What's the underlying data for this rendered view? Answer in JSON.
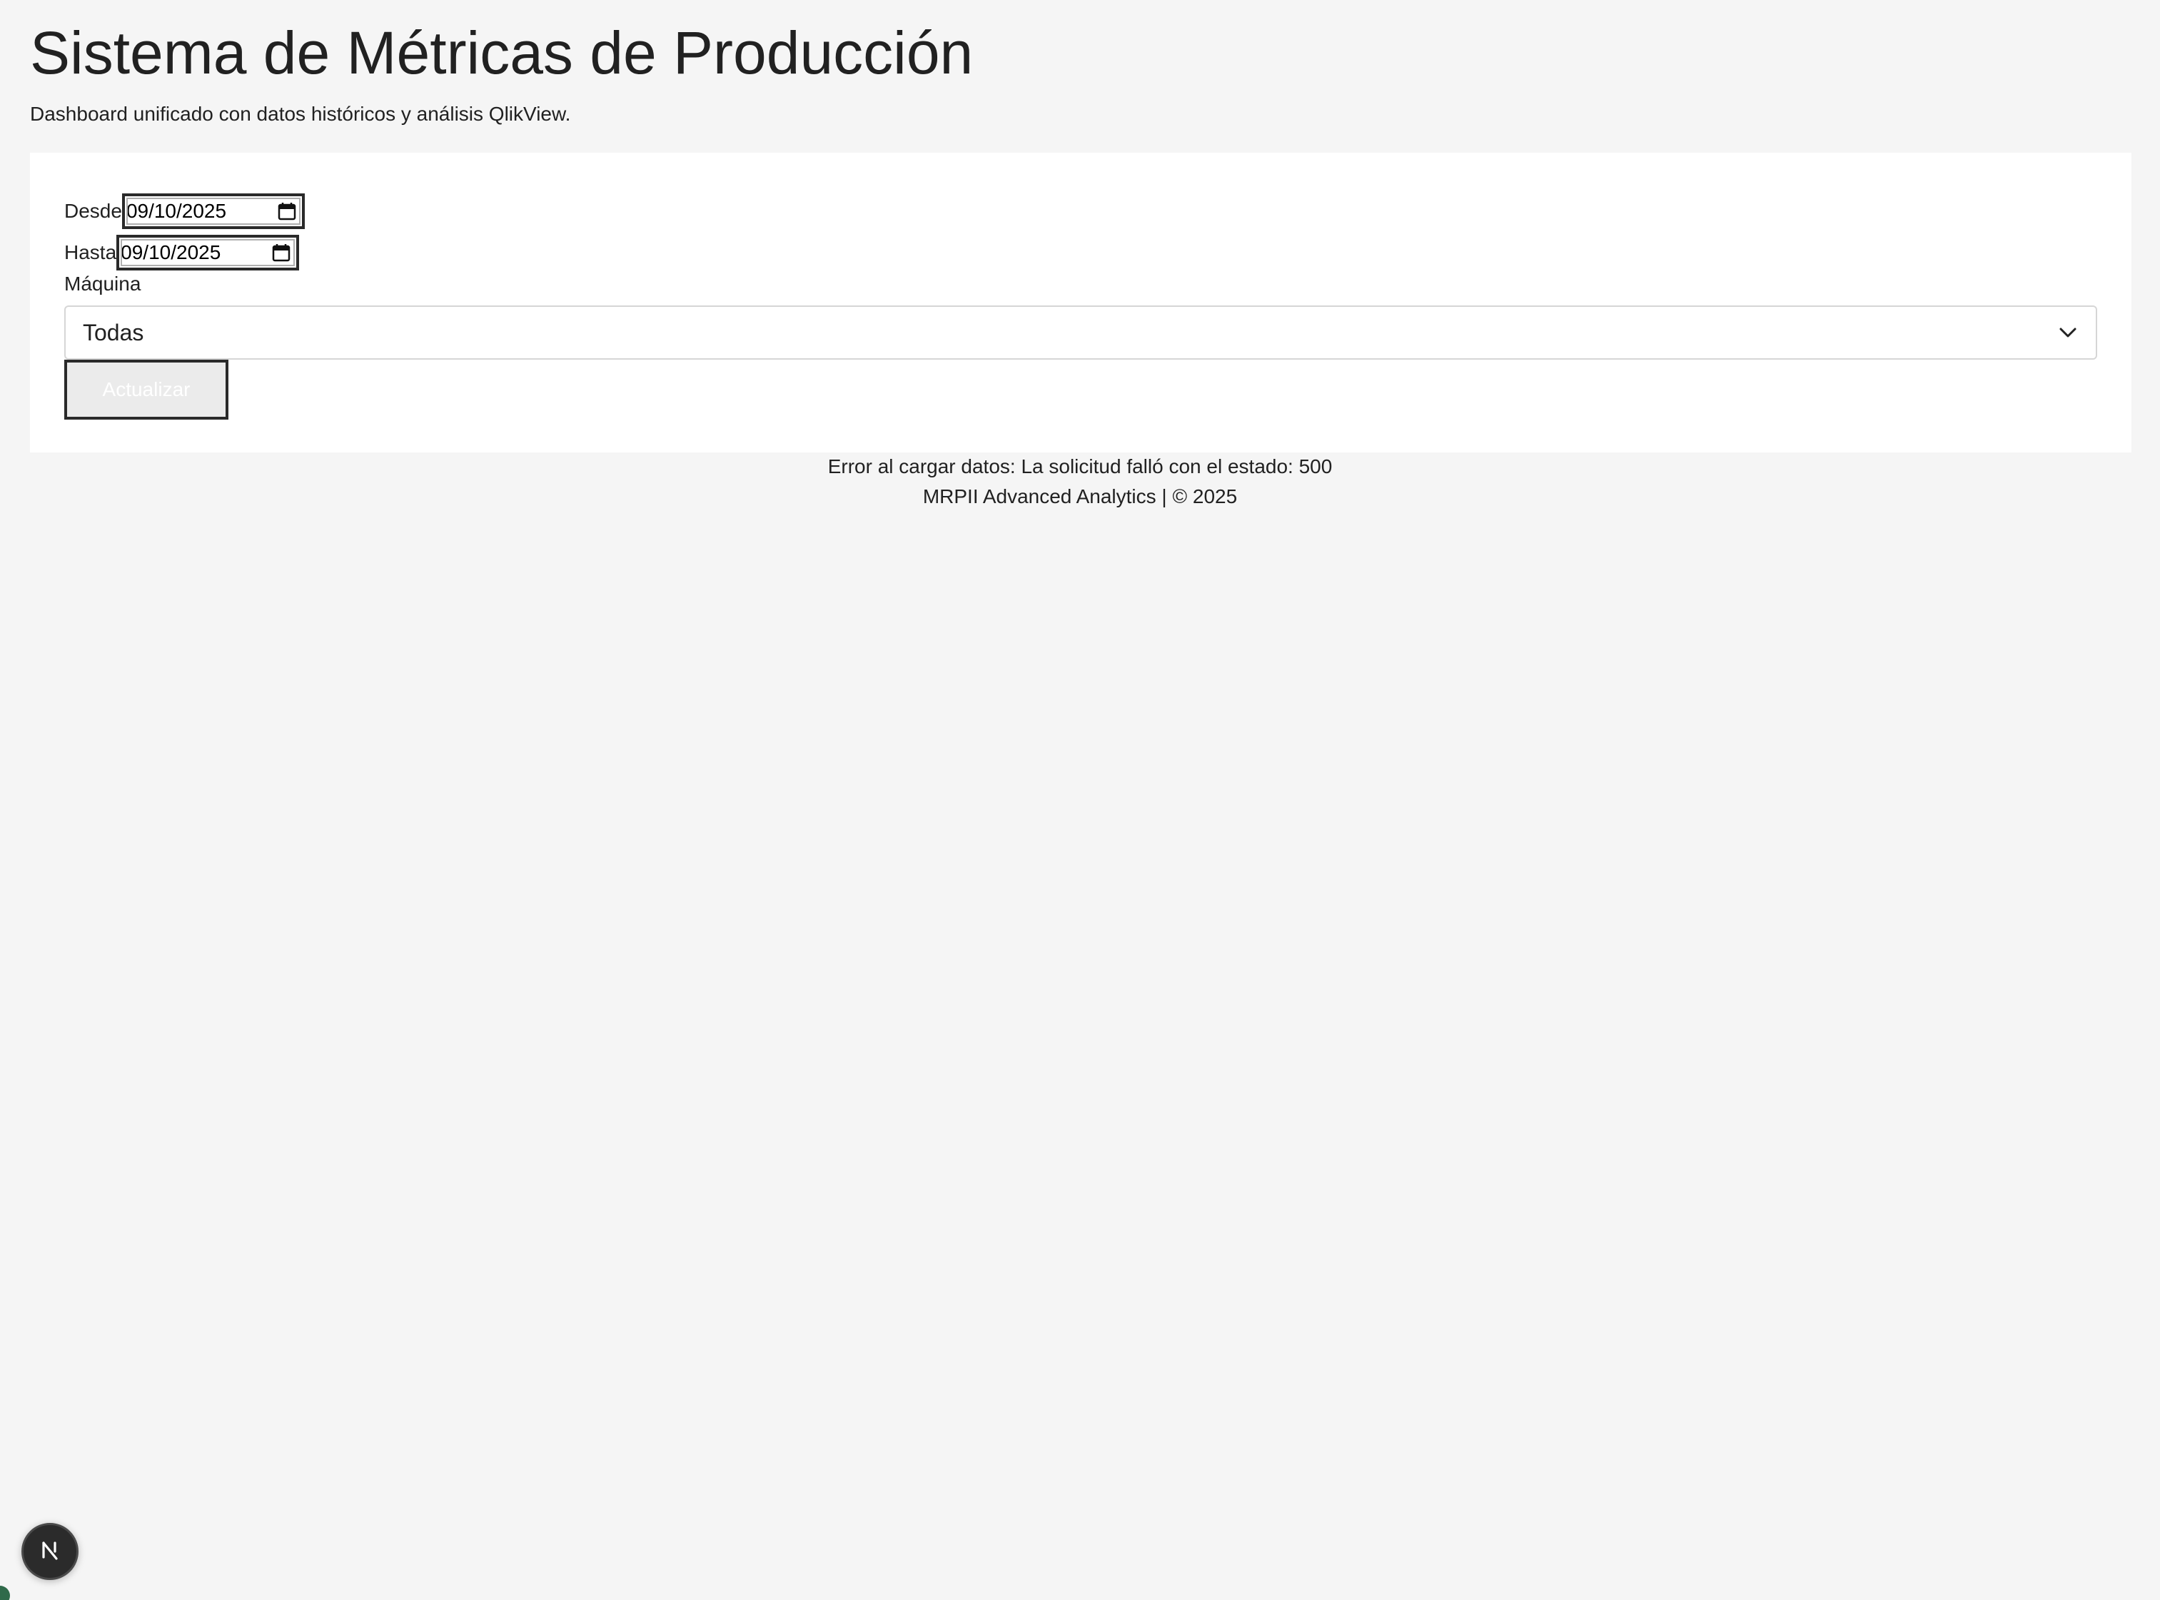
{
  "header": {
    "title": "Sistema de Métricas de Producción",
    "subtitle": "Dashboard unificado con datos históricos y análisis QlikView."
  },
  "filters": {
    "from_label": "Desde",
    "from_value": "09/10/2025",
    "to_label": "Hasta",
    "to_value": "09/10/2025",
    "machine_label": "Máquina",
    "machine_selected": "Todas",
    "update_button_label": "Actualizar"
  },
  "status": {
    "error_message": "Error al cargar datos: La solicitud falló con el estado: 500"
  },
  "footer": {
    "text": "MRPII Advanced Analytics | © 2025"
  },
  "dev_badge": {
    "letter": "N",
    "icon": "nextjs-icon"
  },
  "colors": {
    "background": "#f5f5f5",
    "card": "#ffffff",
    "text": "#212121",
    "badge": "#2b2b2b",
    "accent_corner": "#2f6a4a"
  }
}
